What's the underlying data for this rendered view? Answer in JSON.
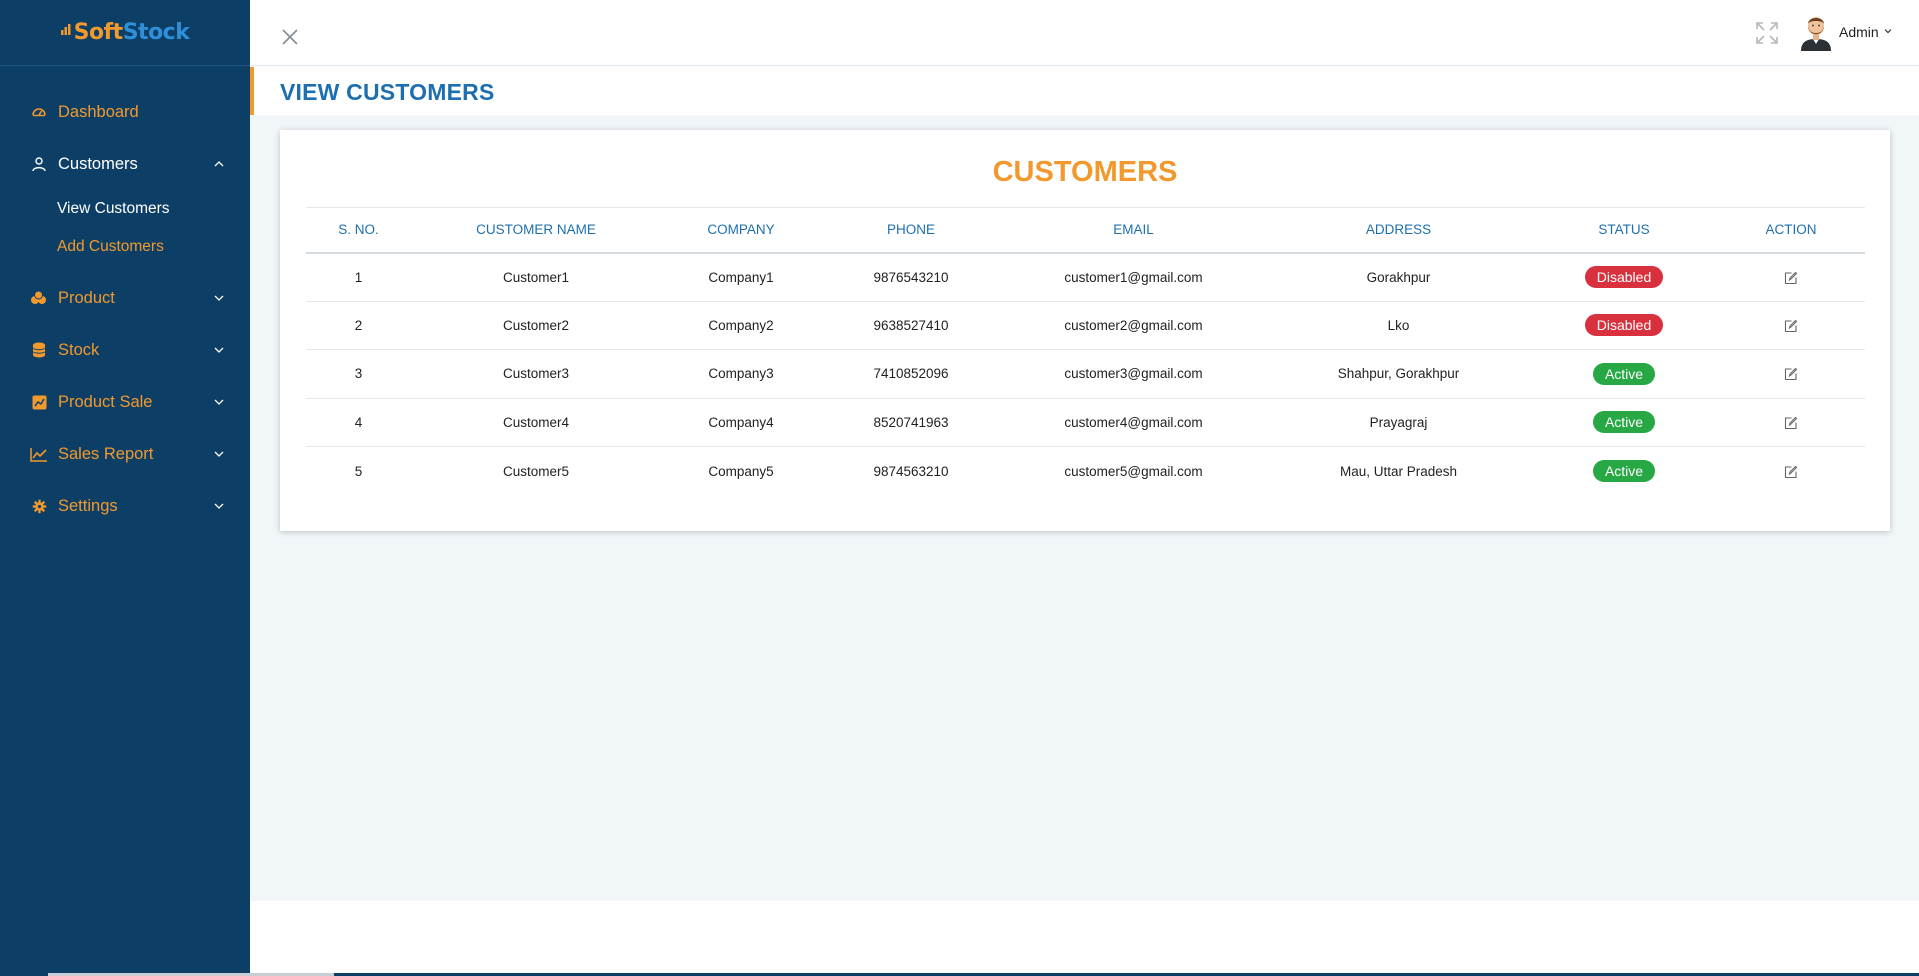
{
  "brand": {
    "part1": "S",
    "part2": "oft",
    "part3": "Stock"
  },
  "sidebar": {
    "items": [
      {
        "label": "Dashboard",
        "icon": "dashboard-gauge-icon"
      },
      {
        "label": "Customers",
        "icon": "user-icon",
        "open": true,
        "sub": [
          {
            "label": "View Customers",
            "active": true
          },
          {
            "label": "Add Customers"
          }
        ]
      },
      {
        "label": "Product",
        "icon": "coins-icon"
      },
      {
        "label": "Stock",
        "icon": "database-icon"
      },
      {
        "label": "Product Sale",
        "icon": "chart-box-icon"
      },
      {
        "label": "Sales Report",
        "icon": "line-chart-icon"
      },
      {
        "label": "Settings",
        "icon": "gear-icon"
      }
    ]
  },
  "topbar": {
    "user_name": "Admin"
  },
  "page": {
    "title": "VIEW CUSTOMERS"
  },
  "card": {
    "title": "CUSTOMERS"
  },
  "table": {
    "headers": [
      "S. NO.",
      "CUSTOMER NAME",
      "COMPANY",
      "PHONE",
      "EMAIL",
      "ADDRESS",
      "STATUS",
      "ACTION"
    ],
    "rows": [
      {
        "sno": "1",
        "name": "Customer1",
        "company": "Company1",
        "phone": "9876543210",
        "email": "customer1@gmail.com",
        "address": "Gorakhpur",
        "status": "Disabled"
      },
      {
        "sno": "2",
        "name": "Customer2",
        "company": "Company2",
        "phone": "9638527410",
        "email": "customer2@gmail.com",
        "address": "Lko",
        "status": "Disabled"
      },
      {
        "sno": "3",
        "name": "Customer3",
        "company": "Company3",
        "phone": "7410852096",
        "email": "customer3@gmail.com",
        "address": "Shahpur, Gorakhpur",
        "status": "Active"
      },
      {
        "sno": "4",
        "name": "Customer4",
        "company": "Company4",
        "phone": "8520741963",
        "email": "customer4@gmail.com",
        "address": "Prayagraj",
        "status": "Active"
      },
      {
        "sno": "5",
        "name": "Customer5",
        "company": "Company5",
        "phone": "9874563210",
        "email": "customer5@gmail.com",
        "address": "Mau, Uttar Pradesh",
        "status": "Active"
      }
    ]
  },
  "colors": {
    "sidebar_bg": "#0d3f66",
    "accent_orange": "#f2992e",
    "accent_blue": "#1d6fb0",
    "disabled_red": "#d9303d",
    "active_green": "#27a844"
  }
}
